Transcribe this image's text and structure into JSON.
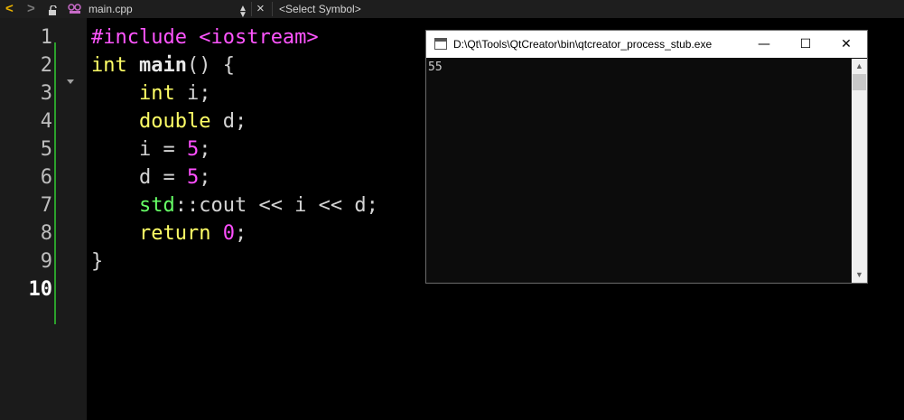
{
  "toolbar": {
    "back_glyph": "<",
    "forward_glyph": ">",
    "file_name": "main.cpp",
    "symbol_selector": "<Select Symbol>",
    "close_glyph": "×"
  },
  "editor": {
    "line_numbers": [
      "1",
      "2",
      "3",
      "4",
      "5",
      "6",
      "7",
      "8",
      "9",
      "10"
    ],
    "current_line": 10,
    "lines": [
      [
        {
          "t": "#include",
          "c": "pre"
        },
        {
          "t": " ",
          "c": "plain"
        },
        {
          "t": "<iostream>",
          "c": "pre"
        }
      ],
      [
        {
          "t": "int",
          "c": "type"
        },
        {
          "t": " ",
          "c": "plain"
        },
        {
          "t": "main",
          "c": "fn"
        },
        {
          "t": "() {",
          "c": "plain"
        }
      ],
      [
        {
          "t": "    ",
          "c": "plain"
        },
        {
          "t": "int",
          "c": "type"
        },
        {
          "t": " i;",
          "c": "plain"
        }
      ],
      [
        {
          "t": "    ",
          "c": "plain"
        },
        {
          "t": "double",
          "c": "type"
        },
        {
          "t": " d;",
          "c": "plain"
        }
      ],
      [
        {
          "t": "    i = ",
          "c": "plain"
        },
        {
          "t": "5",
          "c": "num"
        },
        {
          "t": ";",
          "c": "plain"
        }
      ],
      [
        {
          "t": "    d = ",
          "c": "plain"
        },
        {
          "t": "5",
          "c": "num"
        },
        {
          "t": ";",
          "c": "plain"
        }
      ],
      [
        {
          "t": "    ",
          "c": "plain"
        },
        {
          "t": "std",
          "c": "ns"
        },
        {
          "t": "::cout << i << d;",
          "c": "plain"
        }
      ],
      [
        {
          "t": "    ",
          "c": "plain"
        },
        {
          "t": "return",
          "c": "kw"
        },
        {
          "t": " ",
          "c": "plain"
        },
        {
          "t": "0",
          "c": "num"
        },
        {
          "t": ";",
          "c": "plain"
        }
      ],
      [
        {
          "t": "}",
          "c": "plain"
        }
      ],
      []
    ]
  },
  "console": {
    "title": "D:\\Qt\\Tools\\QtCreator\\bin\\qtcreator_process_stub.exe",
    "output": "55",
    "minimize_glyph": "—",
    "maximize_glyph": "☐",
    "close_glyph": "✕"
  },
  "colors": {
    "editor_bg": "#000000",
    "gutter_bg": "#1b1b1b",
    "change_bar": "#2ca02c",
    "preprocessor": "#ff55ff",
    "type_keyword": "#ffff66",
    "number": "#ff4fff",
    "namespace": "#66ff66"
  }
}
